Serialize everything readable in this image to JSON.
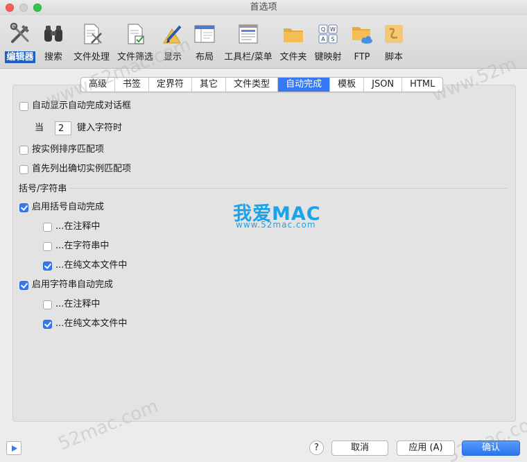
{
  "window": {
    "title": "首选项"
  },
  "toolbar": {
    "items": [
      {
        "label": "编辑器",
        "icon": "tools-icon"
      },
      {
        "label": "搜索",
        "icon": "binoculars-icon"
      },
      {
        "label": "文件处理",
        "icon": "document-tools-icon"
      },
      {
        "label": "文件筛选",
        "icon": "document-filter-icon"
      },
      {
        "label": "显示",
        "icon": "pen-display-icon"
      },
      {
        "label": "布局",
        "icon": "layout-window-icon"
      },
      {
        "label": "工具栏/菜单",
        "icon": "toolbar-menu-icon"
      },
      {
        "label": "文件夹",
        "icon": "folder-icon"
      },
      {
        "label": "键映射",
        "icon": "keymap-icon"
      },
      {
        "label": "FTP",
        "icon": "ftp-folder-icon"
      },
      {
        "label": "脚本",
        "icon": "script-scroll-icon"
      }
    ]
  },
  "tabs": [
    "高级",
    "书签",
    "定界符",
    "其它",
    "文件类型",
    "自动完成",
    "模板",
    "JSON",
    "HTML"
  ],
  "active_tab": "自动完成",
  "options": {
    "auto_show_dialog": {
      "label": "自动显示自动完成对话框",
      "checked": false
    },
    "when_label": "当",
    "char_count": "2",
    "typed_suffix": "键入字符时",
    "sort_by_instance": {
      "label": "按实例排序匹配项",
      "checked": false
    },
    "exact_first": {
      "label": "首先列出确切实例匹配项",
      "checked": false
    }
  },
  "brackets_section": {
    "title": "括号/字符串",
    "enable_bracket": {
      "label": "启用括号自动完成",
      "checked": true
    },
    "bracket_in_comment": {
      "label": "...在注释中",
      "checked": false
    },
    "bracket_in_string": {
      "label": "...在字符串中",
      "checked": false
    },
    "bracket_in_plaintext": {
      "label": "...在纯文本文件中",
      "checked": true
    },
    "enable_string": {
      "label": "启用字符串自动完成",
      "checked": true
    },
    "string_in_comment": {
      "label": "...在注释中",
      "checked": false
    },
    "string_in_plaintext": {
      "label": "...在纯文本文件中",
      "checked": true
    }
  },
  "watermark": {
    "logo": "我爱MAC",
    "url": "www.52mac.com",
    "tile_a": "www.52mac.com",
    "tile_b": "52mac.com",
    "tile_c": "www.52m"
  },
  "footer": {
    "help": "?",
    "cancel": "取消",
    "apply": "应用 (A)",
    "ok": "确认"
  },
  "colors": {
    "accent": "#3478f6",
    "selected_toolbar": "#1f5fbf",
    "logo": "#1aa3e8"
  }
}
